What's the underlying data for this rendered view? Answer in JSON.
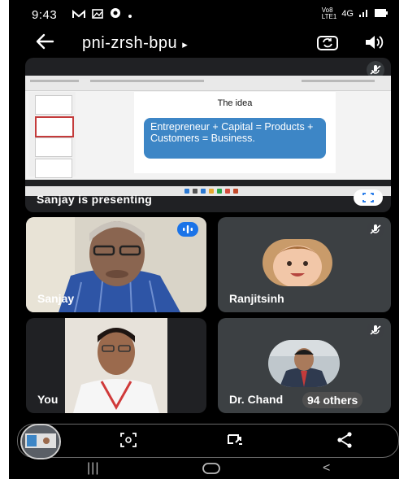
{
  "status_bar": {
    "time": "9:43",
    "network_top": "Vo8",
    "network_bottom": "LTE1",
    "signal": "4G"
  },
  "header": {
    "meeting_code": "pni-zrsh-bpu",
    "code_arrow": "▸"
  },
  "presentation": {
    "slide_title": "The idea",
    "slide_text": "Entrepreneur + Capital = Products + Customers = Business.",
    "presenter_label": "Sanjay is presenting"
  },
  "participants": [
    {
      "name": "Sanjay"
    },
    {
      "name": "Ranjitsinh"
    },
    {
      "name": "You"
    },
    {
      "name": "Dr. Chand",
      "others": "94 others"
    }
  ],
  "colors": {
    "background": "#000000",
    "tile": "#3c4043",
    "slide_box": "#3d86c6",
    "speaking": "#4285f4"
  },
  "icons": {
    "back": "arrow-left-icon",
    "camera_flip": "camera-flip-icon",
    "speaker": "speaker-icon",
    "mic_off": "mic-off-icon",
    "fullscreen": "fullscreen-icon",
    "speaking": "speaking-indicator-icon",
    "camera_frame": "camera-frame-icon",
    "screen_cast": "screen-cast-icon",
    "share": "share-icon"
  },
  "nav": {
    "recents": "|||",
    "back": "<"
  }
}
